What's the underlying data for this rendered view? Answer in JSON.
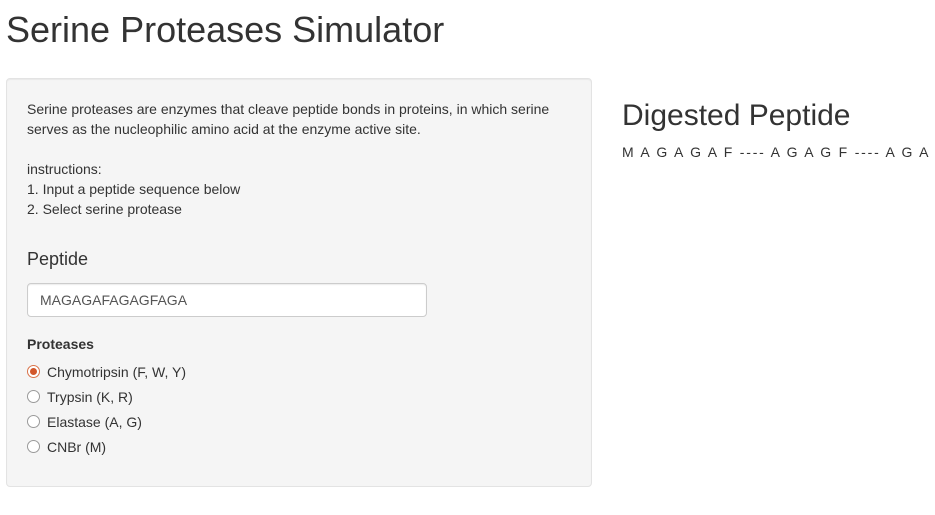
{
  "app": {
    "title": "Serine Proteases Simulator"
  },
  "sidebar": {
    "description": [
      "Serine proteases are enzymes that cleave peptide bonds in proteins, in which serine",
      "serves as the nucleophilic amino acid at the enzyme active site."
    ],
    "instructions": [
      "instructions:",
      "1. Input a peptide sequence below",
      "2. Select serine protease"
    ],
    "peptide": {
      "label": "Peptide",
      "value": "MAGAGAFAGAGFAGA"
    },
    "proteases": {
      "label": "Proteases",
      "selected": "Chymotripsin (F, W, Y)",
      "options": [
        "Chymotripsin (F, W, Y)",
        "Trypsin (K, R)",
        "Elastase (A, G)",
        "CNBr (M)"
      ]
    }
  },
  "main": {
    "result_title": "Digested Peptide",
    "result_text": "M A G A G A F ---- A G A G F ---- A G A ----"
  },
  "colors": {
    "accent": "#d2572b",
    "text": "#333333",
    "well_bg": "#f5f5f5"
  }
}
